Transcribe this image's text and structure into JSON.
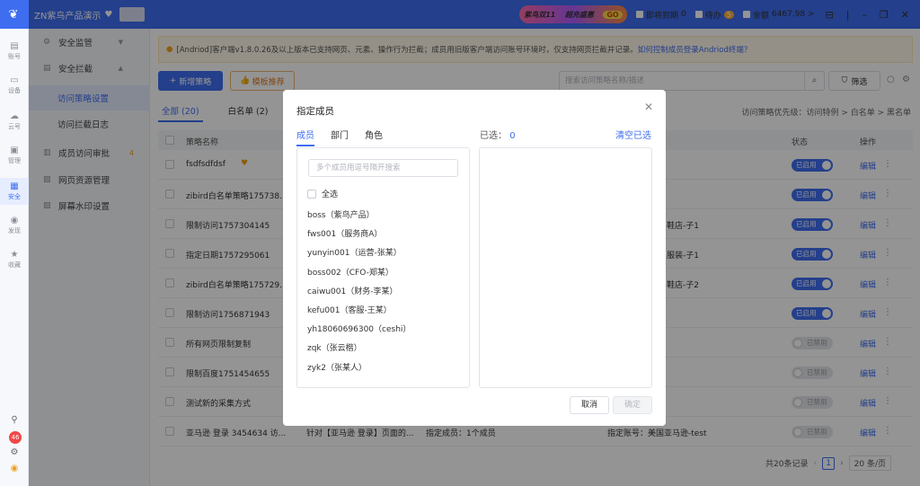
{
  "topbar": {
    "title": "ZN紫鸟产品演示",
    "promo_text1": "紫鸟双11",
    "promo_text2": "超充盛惠",
    "promo_badge": "GO",
    "expiring_label": "即将到期",
    "expiring_count": "0",
    "pending_label": "待办",
    "pending_count": "5",
    "balance_label": "余额",
    "balance_value": "6467.98",
    "balance_arrow": ">"
  },
  "sidebar": {
    "items": [
      {
        "label": "账号",
        "icon": "account-icon"
      },
      {
        "label": "设备",
        "icon": "device-icon"
      },
      {
        "label": "云号",
        "icon": "cloud-icon"
      },
      {
        "label": "管理",
        "icon": "manage-icon"
      },
      {
        "label": "安全",
        "icon": "security-icon"
      },
      {
        "label": "发现",
        "icon": "discover-icon"
      },
      {
        "label": "收藏",
        "icon": "star-icon"
      }
    ],
    "badge": "46"
  },
  "nav": {
    "security_monitor": "安全监管",
    "security_block": "安全拦截",
    "access_policy": "访问策略设置",
    "block_log": "访问拦截日志",
    "member_approval": "成员访问审批",
    "member_approval_badge": "4",
    "web_resource": "网页资源管理",
    "watermark": "屏幕水印设置"
  },
  "notice": {
    "text": "[Andriod]客户端v1.8.0.26及以上版本已支持网页、元素、操作行为拦截；成员用旧版客户端访问账号环境时，仅支持网页拦截并记录。",
    "link": "如何控制成员登录Andriod终端？"
  },
  "toolbar": {
    "add_label": "新增策略",
    "template_label": "模板推荐",
    "search_placeholder": "搜索访问策略名称/描述",
    "filter_label": "筛选"
  },
  "tabs": [
    {
      "label": "全部 (20)"
    },
    {
      "label": "白名单 (2)"
    }
  ],
  "priority_text": "访问策略优先级：访问特例 > 白名单 > 黑名单",
  "table": {
    "headers": {
      "name": "策略名称",
      "status": "状态",
      "action": "操作"
    },
    "rows": [
      {
        "name": "fsdfsdfdsf",
        "extra": "",
        "status": "已启用",
        "on": true
      },
      {
        "name": "zibird白名单策略175738...",
        "extra": "",
        "status": "已启用",
        "on": true
      },
      {
        "name": "限制访问1757304145",
        "extra": "鞋店-子1",
        "status": "已启用",
        "on": true
      },
      {
        "name": "指定日期1757295061",
        "extra": "服装-子1",
        "status": "已启用",
        "on": true
      },
      {
        "name": "zibird白名单策略175729...",
        "extra": "鞋店-子2",
        "status": "已启用",
        "on": true
      },
      {
        "name": "限制访问1756871943",
        "extra": "",
        "status": "已启用",
        "on": true
      },
      {
        "name": "所有网页限制复制",
        "extra": "",
        "status": "已禁用",
        "on": false
      },
      {
        "name": "限制百度1751454655",
        "extra": "",
        "status": "已禁用",
        "on": false
      },
      {
        "name": "测试新的采集方式",
        "extra": "",
        "status": "已禁用",
        "on": false
      },
      {
        "name": "亚马逊 登录 3454634 访...",
        "desc": "针对【亚马逊 登录】页面的...",
        "members": "指定成员：1个成员",
        "extra": "指定账号：美国亚马逊-test",
        "status": "已禁用",
        "on": false
      }
    ],
    "edit_label": "编辑",
    "more_label": "⋮"
  },
  "pagination": {
    "total": "共20条记录",
    "current": "1",
    "size": "20 条/页"
  },
  "modal": {
    "title": "指定成员",
    "tabs": [
      "成员",
      "部门",
      "角色"
    ],
    "selected_label": "已选：",
    "selected_count": "0",
    "clear_label": "清空已选",
    "search_placeholder": "多个成员用逗号隔开搜索",
    "select_all": "全选",
    "members": [
      "boss（紫鸟产品）",
      "fws001（服务商A）",
      "yunyin001（运营-张某）",
      "boss002（CFO-郑某）",
      "caiwu001（财务-李某）",
      "kefu001（客服-王某）",
      "yh18060696300（ceshi）",
      "zqk（张云楷）",
      "zyk2（张某人）"
    ],
    "cancel_label": "取消",
    "ok_label": "确定"
  }
}
